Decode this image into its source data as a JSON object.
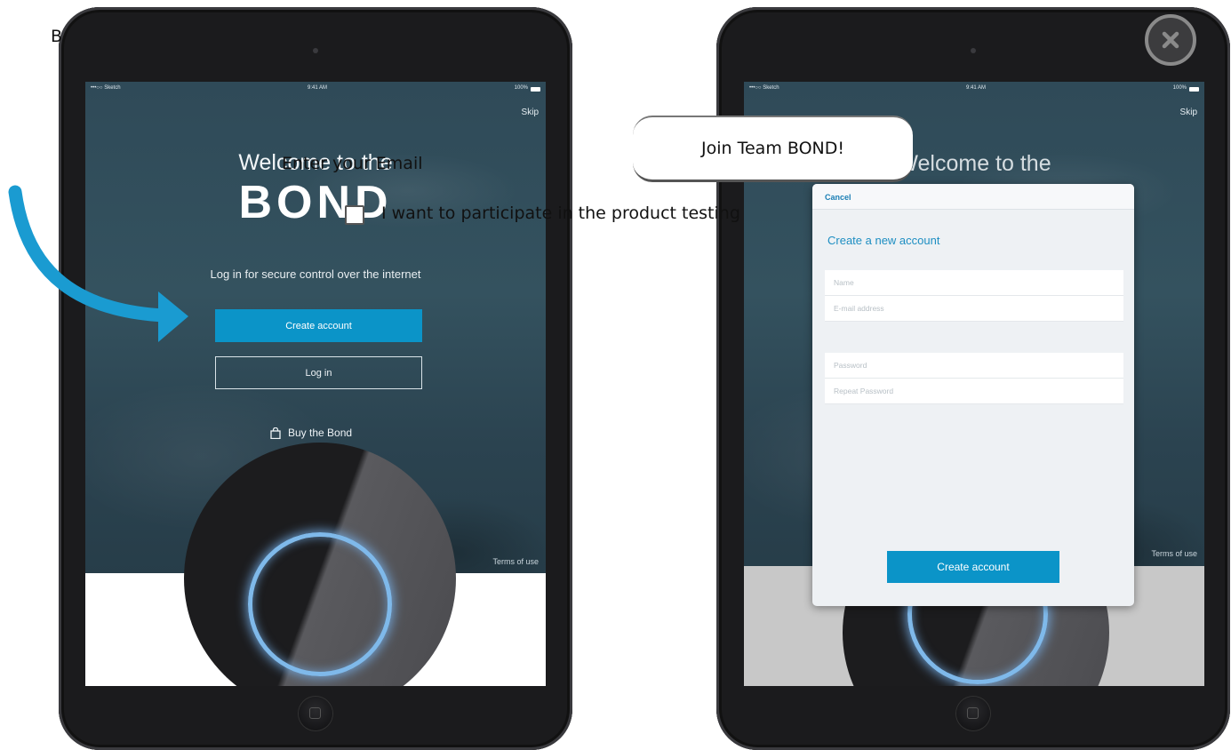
{
  "overlay": {
    "corner_text": "B",
    "email_label": "Enter your Email",
    "checkbox_label": "I want to participate in the product testing",
    "join_button": "Join Team BOND!",
    "close_icon": "close-icon"
  },
  "left_screen": {
    "status_carrier": "•••○○ Sketch",
    "status_time": "9:41 AM",
    "status_battery": "100%",
    "skip": "Skip",
    "welcome": "Welcome to the",
    "logo": "BOND",
    "tagline": "Log in for secure control over the internet",
    "create_account": "Create account",
    "log_in": "Log in",
    "buy": "Buy the Bond",
    "buy_icon": "shopping-bag-icon",
    "terms": "Terms of use"
  },
  "right_screen": {
    "status_carrier": "•••○○ Sketch",
    "status_time": "9:41 AM",
    "status_battery": "100%",
    "skip": "Skip",
    "welcome": "Welcome to the",
    "terms": "Terms of use",
    "modal": {
      "cancel": "Cancel",
      "title": "Create a new account",
      "name_placeholder": "Name",
      "email_placeholder": "E-mail address",
      "password_placeholder": "Password",
      "repeat_password_placeholder": "Repeat Password",
      "submit": "Create account"
    }
  },
  "colors": {
    "accent": "#0b94c8",
    "arrow": "#1a9bd1",
    "ring_glow": "#7fb9ea"
  }
}
